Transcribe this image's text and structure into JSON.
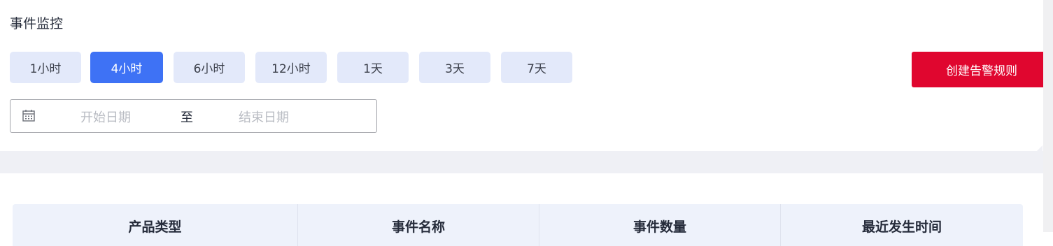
{
  "page_title": "事件监控",
  "time_ranges": {
    "options": [
      "1小时",
      "4小时",
      "6小时",
      "12小时",
      "1天",
      "3天",
      "7天"
    ],
    "selected": "4小时"
  },
  "create_alert_rule_label": "创建告警规则",
  "date_range": {
    "start_placeholder": "开始日期",
    "separator": "至",
    "end_placeholder": "结束日期"
  },
  "table": {
    "columns": [
      "产品类型",
      "事件名称",
      "事件数量",
      "最近发生时间"
    ]
  },
  "colors": {
    "accent": "#3e72f5",
    "danger": "#e0062f",
    "chip_bg": "#e3e9fa",
    "header_bg": "#eef2fb"
  }
}
